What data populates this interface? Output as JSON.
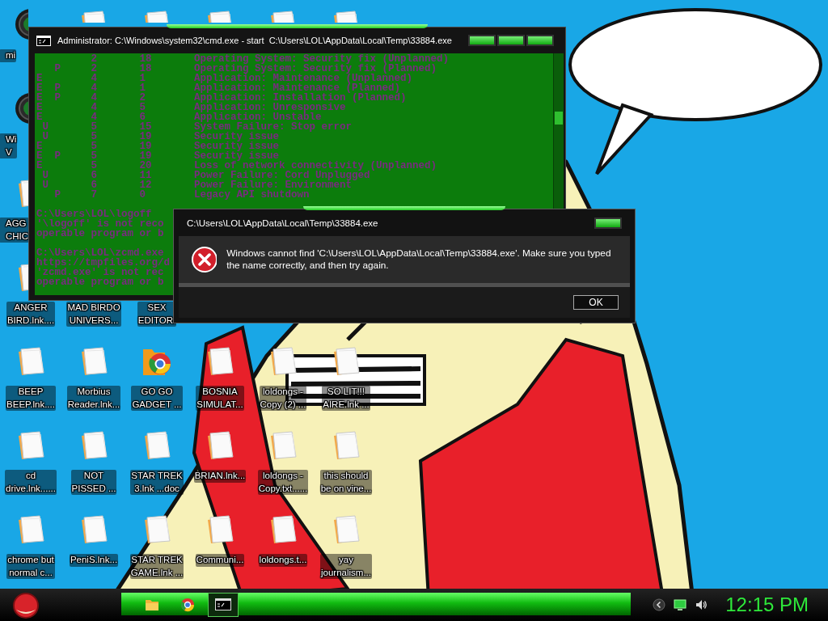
{
  "desktop": {
    "icon_rows": [
      [
        {
          "kind": "disc",
          "label": "mi"
        },
        {
          "kind": "document"
        },
        {
          "kind": "document"
        },
        {
          "kind": "document"
        },
        {
          "kind": "document"
        },
        {
          "kind": "document"
        }
      ],
      [
        {
          "kind": "disc",
          "label": "Wi\nV"
        }
      ],
      [
        {
          "kind": "document",
          "label": "AGG\nCHIC"
        }
      ],
      [
        {
          "kind": "document",
          "label": "ANGER\nBIRD.lnk...."
        },
        {
          "kind": "label_only",
          "label": "MAD BIRDO\nUNIVERS..."
        },
        {
          "kind": "label_only",
          "label": "SEX\nEDITOR."
        }
      ],
      [
        {
          "kind": "document",
          "label": "BEEP\nBEEP.lnk...."
        },
        {
          "kind": "document",
          "label": "Morbius\nReader.lnk..."
        },
        {
          "kind": "browser_folder",
          "label": "GO GO\nGADGET ..."
        },
        {
          "kind": "document",
          "label": "BOSNIA\nSIMULAT..."
        },
        {
          "kind": "document",
          "label": "loldongs -\nCopy (2) ..."
        },
        {
          "kind": "document",
          "label": "SO LIT!!!\nAIRE.lnk ..."
        }
      ],
      [
        {
          "kind": "document",
          "label": "cd\ndrive.lnk......"
        },
        {
          "kind": "document",
          "label": "NOT\nPISSED ..."
        },
        {
          "kind": "document",
          "label": "STAR TREK\n3.lnk ...doc"
        },
        {
          "kind": "document",
          "label": "BRIAN.lnk..."
        },
        {
          "kind": "document",
          "label": "loldongs -\nCopy.txt......"
        },
        {
          "kind": "document",
          "label": "this should\nbe on vine..."
        }
      ],
      [
        {
          "kind": "document",
          "label": "chrome but\nnormal c..."
        },
        {
          "kind": "document",
          "label": "PeniS.lnk..."
        },
        {
          "kind": "document",
          "label": "STAR TREK\nGAME.lnk ..."
        },
        {
          "kind": "document",
          "label": "Communi..."
        },
        {
          "kind": "document",
          "label": "loldongs.t..."
        },
        {
          "kind": "document",
          "label": "yay\njournalism..."
        }
      ]
    ]
  },
  "console_window": {
    "title": "Administrator: C:\\Windows\\system32\\cmd.exe - start  C:\\Users\\LOL\\AppData\\Local\\Temp\\33884.exe",
    "table_lines": [
      "         2       18       Operating System: Security fix (Unplanned)",
      "   P     2       18       Operating System: Security fix (Planned)",
      "E        4       1        Application: Maintenance (Unplanned)",
      "E  P     4       1        Application: Maintenance (Planned)",
      "E  P     4       2        Application: Installation (Planned)",
      "E        4       5        Application: Unresponsive",
      "E        4       6        Application: Unstable",
      " U       5       15       System Failure: Stop error",
      " U       5       19       Security issue",
      "E        5       19       Security issue",
      "E  P     5       19       Security issue",
      "E        5       20       Loss of network connectivity (Unplanned)",
      " U       6       11       Power Failure: Cord Unplugged",
      " U       6       12       Power Failure: Environment",
      "   P     7       0        Legacy API shutdown"
    ],
    "output_blocks": [
      [
        "C:\\Users\\LOL\\logoff",
        "'\\logoff' is not reco",
        "operable program or b"
      ],
      [
        "C:\\Users\\LOL\\zcmd.exe",
        "https://tmpfiles.org/d",
        "'zcmd.exe' is not rec",
        "operable program or b"
      ]
    ]
  },
  "error_dialog": {
    "title": "C:\\Users\\LOL\\AppData\\Local\\Temp\\33884.exe",
    "message": "Windows cannot find 'C:\\Users\\LOL\\AppData\\Local\\Temp\\33884.exe'. Make sure you typed the name correctly, and then try again.",
    "buttons": [
      "OK"
    ]
  },
  "taskbar": {
    "items": [
      {
        "kind": "folder",
        "selected": false
      },
      {
        "kind": "browser",
        "selected": false
      },
      {
        "kind": "console",
        "selected": true
      }
    ],
    "clock": "12:15 PM"
  }
}
